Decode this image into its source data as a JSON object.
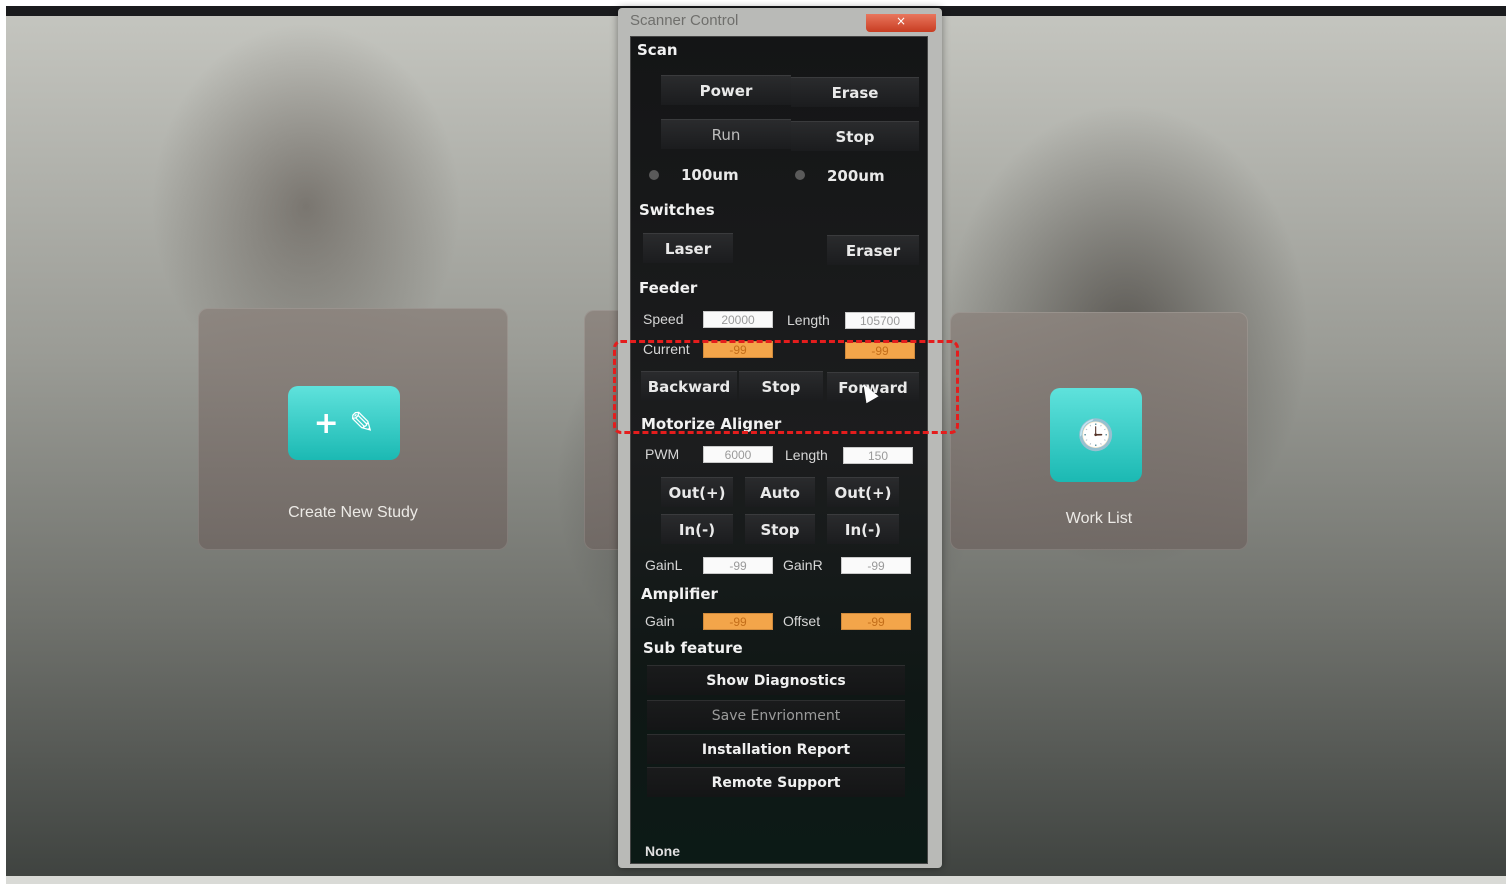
{
  "launcher": {
    "create_new_study": "Create New Study",
    "work_list": "Work List"
  },
  "window": {
    "title": "Scanner Control",
    "close_glyph": "×"
  },
  "scan": {
    "heading": "Scan",
    "power": "Power",
    "erase": "Erase",
    "run": "Run",
    "stop": "Stop",
    "res_100": "100um",
    "res_200": "200um"
  },
  "switches": {
    "heading": "Switches",
    "laser": "Laser",
    "eraser": "Eraser"
  },
  "feeder": {
    "heading": "Feeder",
    "speed_label": "Speed",
    "speed_value": "20000",
    "length_label": "Length",
    "length_value": "105700",
    "current_label": "Current",
    "current_value_1": "-99",
    "current_value_2": "-99",
    "backward": "Backward",
    "stop": "Stop",
    "forward": "Forward"
  },
  "aligner": {
    "heading": "Motorize Aligner",
    "pwm_label": "PWM",
    "pwm_value": "6000",
    "length_label": "Length",
    "length_value": "150",
    "out_left": "Out(+)",
    "auto": "Auto",
    "out_right": "Out(+)",
    "in_left": "In(-)",
    "stop": "Stop",
    "in_right": "In(-)",
    "gainl_label": "GainL",
    "gainl_value": "-99",
    "gainr_label": "GainR",
    "gainr_value": "-99"
  },
  "amplifier": {
    "heading": "Amplifier",
    "gain_label": "Gain",
    "gain_value": "-99",
    "offset_label": "Offset",
    "offset_value": "-99"
  },
  "sub_feature": {
    "heading": "Sub feature",
    "show_diagnostics": "Show Diagnostics",
    "save_environment": "Save Envrionment",
    "installation_report": "Installation Report",
    "remote_support": "Remote Support"
  },
  "status": {
    "text": "None"
  },
  "colors": {
    "accent_teal": "#2ec9c2",
    "field_orange": "#f3a54a",
    "highlight_red": "#e41d1d"
  }
}
